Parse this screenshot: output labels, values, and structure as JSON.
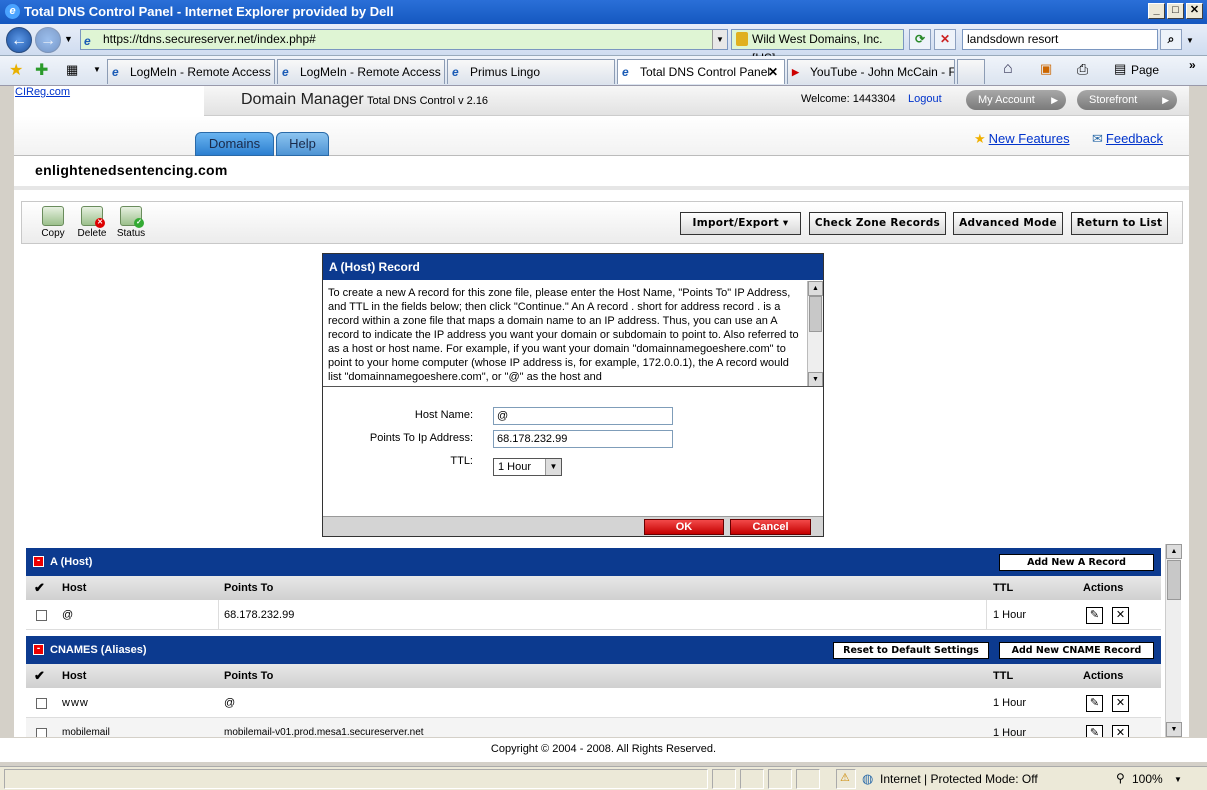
{
  "window": {
    "title": "Total DNS Control Panel - Internet Explorer provided by Dell"
  },
  "browser": {
    "url": "https://tdns.secureserver.net/index.php#",
    "cert": "Wild West Domains, Inc. [US]",
    "search": "landsdown resort",
    "tabs": [
      {
        "label": "LogMeIn - Remote Access ..."
      },
      {
        "label": "LogMeIn - Remote Access ..."
      },
      {
        "label": "Primus Lingo"
      },
      {
        "label": "Total DNS Control Panel"
      },
      {
        "label": "YouTube - John McCain - F..."
      }
    ],
    "page_menu": "Page"
  },
  "header": {
    "cireg": "CIReg.com",
    "app_title": "Domain Manager",
    "app_sub": "Total DNS Control v 2.16",
    "welcome": "Welcome: 1443304",
    "logout": "Logout",
    "my_account": "My Account",
    "storefront": "Storefront"
  },
  "nav": {
    "domains": "Domains",
    "help": "Help",
    "new_features": "New Features",
    "feedback": "Feedback"
  },
  "domain": "enlightenedsentencing.com",
  "toolbar": {
    "copy": "Copy",
    "delete": "Delete",
    "status": "Status",
    "import_export": "Import/Export ▾",
    "check_zone": "Check Zone Records",
    "advanced": "Advanced Mode",
    "return": "Return to List"
  },
  "dialog": {
    "title": "A (Host) Record",
    "description": "To create a new A record for this zone file, please enter the Host Name, \"Points To\" IP Address, and TTL in the fields below; then click \"Continue.\" An A record . short for address record . is a record within a zone file that maps a domain name to an IP address. Thus, you can use an A record to indicate the IP address you want your domain or subdomain to point to. Also referred to as a host or host name. For example, if you want your domain \"domainnamegoeshere.com\" to point to your home computer (whose IP address is, for example, 172.0.0.1), the A record would list \"domainnamegoeshere.com\", or \"@\" as the host and",
    "host_label": "Host Name:",
    "host_value": "@",
    "points_label": "Points To Ip Address:",
    "points_value": "68.178.232.99",
    "ttl_label": "TTL:",
    "ttl_value": "1 Hour",
    "ok": "OK",
    "cancel": "Cancel"
  },
  "a_section": {
    "title": "A (Host)",
    "add_button": "Add New A Record",
    "cols": {
      "host": "Host",
      "points": "Points To",
      "ttl": "TTL",
      "actions": "Actions"
    },
    "rows": [
      {
        "host": "@",
        "points": "68.178.232.99",
        "ttl": "1 Hour"
      }
    ]
  },
  "cname_section": {
    "title": "CNAMES (Aliases)",
    "reset_button": "Reset to Default Settings",
    "add_button": "Add New CNAME Record",
    "cols": {
      "host": "Host",
      "points": "Points To",
      "ttl": "TTL",
      "actions": "Actions"
    },
    "rows": [
      {
        "host": "www",
        "points": "@",
        "ttl": "1 Hour"
      },
      {
        "host": "mobilemail",
        "points": "mobilemail-v01.prod.mesa1.secureserver.net",
        "ttl": "1 Hour"
      }
    ]
  },
  "footer": {
    "copyright": "Copyright © 2004 - 2008. All Rights Reserved."
  },
  "status": {
    "zone": "Internet | Protected Mode: Off",
    "zoom": "100%"
  }
}
